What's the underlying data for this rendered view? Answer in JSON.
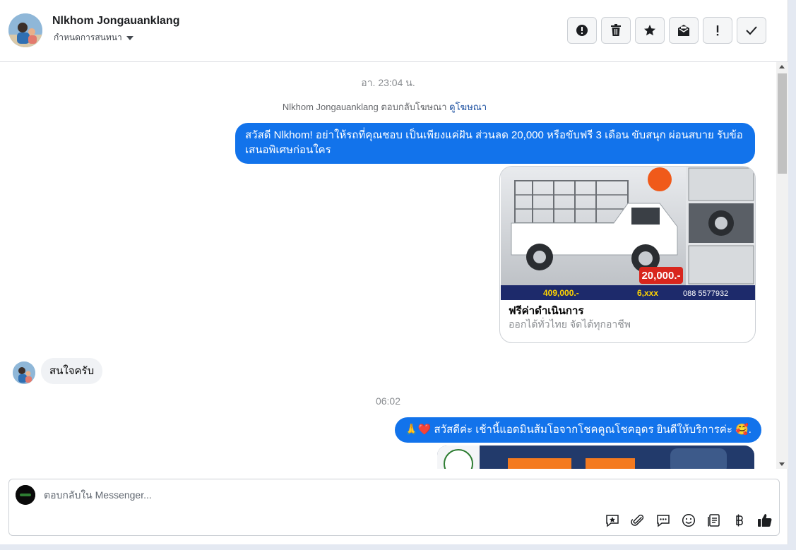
{
  "header": {
    "contact_name": "Nlkhom Jongauanklang",
    "assign_label": "กำหนดการสนทนา"
  },
  "thread": {
    "time_1": "อา. 23:04 น.",
    "ad_reply_text": "Nlkhom Jongauanklang ตอบกลับโฆษณา",
    "ad_link": "ดูโฆษณา",
    "message_1": "สวัสดี Nlkhom! อย่าให้รถที่คุณชอบ เป็นเพียงแค่ฝัน ส่วนลด 20,000 หรือขับฟรี 3 เดือน ขับสนุก ผ่อนสบาย รับข้อเสนอพิเศษก่อนใคร",
    "ad_card": {
      "title": "ฟรีค่าดำเนินการ",
      "subtitle": "ออกได้ทั่วไทย จัดได้ทุกอาชีพ",
      "image_text": {
        "discount": "20,000.-",
        "price": "409,000.-",
        "installment": "6,xxx",
        "phone": "088 5577932"
      }
    },
    "incoming_message": "สนใจครับ",
    "time_2": "06:02",
    "message_2": "🙏❤️ สวัสดีค่ะ เช้านี้แอดมินส้มโอจากโชคคูณโชคอุดร ยินดีให้บริการค่ะ 🥰."
  },
  "composer": {
    "placeholder": "ตอบกลับใน Messenger..."
  },
  "colors": {
    "outgoing_bubble": "#1273eb",
    "incoming_bubble": "#f0f2f5",
    "link": "#1b4fa0"
  },
  "icons": {
    "toolbar": [
      "alert-circle-icon",
      "trash-icon",
      "star-icon",
      "mark-unread-icon",
      "exclamation-icon",
      "check-icon"
    ],
    "composer": [
      "saved-reply-icon",
      "attachment-icon",
      "chat-icon",
      "emoji-icon",
      "form-icon",
      "baht-icon",
      "thumbs-up-icon"
    ]
  }
}
